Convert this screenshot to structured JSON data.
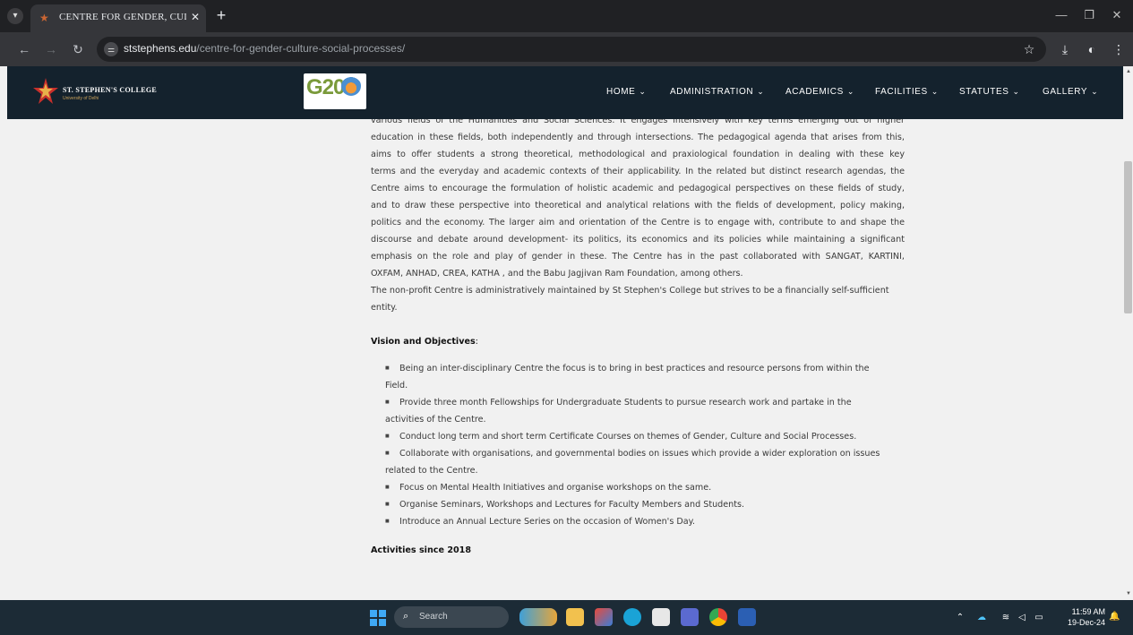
{
  "browser": {
    "tab_title": "CENTRE FOR GENDER, CULTUR",
    "url_host": "ststephens.edu",
    "url_path": "/centre-for-gender-culture-social-processes/"
  },
  "site": {
    "college_name": "ST. STEPHEN'S COLLEGE",
    "college_sub": "University of Delhi",
    "g20_label": "G20",
    "menu": [
      {
        "label": "HOME"
      },
      {
        "label": "ADMINISTRATION"
      },
      {
        "label": "ACADEMICS"
      },
      {
        "label": "FACILITIES"
      },
      {
        "label": "STATUTES"
      },
      {
        "label": "GALLERY"
      }
    ]
  },
  "content": {
    "para_lines": [
      "various fields of the Humanities and Social Sciences. It engages intensively with key terms emerging out of higher",
      "education in these fields, both independently and through intersections. The pedagogical agenda that arises from this,",
      "aims to offer students  a strong theoretical, methodological and praxiological foundation in dealing with these key",
      "terms and the everyday and academic contexts of their applicability. In the related but distinct research agendas, the",
      "Centre aims to encourage the formulation of holistic academic and pedagogical perspectives on these fields of study,",
      "and to draw these perspective into theoretical and analytical relations with the fields of development, policy making,",
      "politics and the economy. The larger aim and orientation of the Centre is to engage with, contribute to and shape the",
      "discourse and debate around development- its politics, its economics and its policies while maintaining a significant",
      "emphasis on the role and play of gender in these. The Centre has in the past collaborated with SANGAT, KARTINI,",
      "OXFAM, ANHAD, CREA, KATHA , and the Babu Jagjivan Ram Foundation, among others."
    ],
    "para2_line1": "The non-profit Centre is administratively maintained by St Stephen's College but strives to be a financially self-sufficient",
    "para2_line2": "entity.",
    "vision_heading": "Vision and Objectives",
    "vision_colon": ":",
    "objectives": [
      {
        "l1": "Being an inter-disciplinary Centre the focus is to bring in best practices and resource persons from within the",
        "l2": "Field."
      },
      {
        "l1": "Provide three month Fellowships for Undergraduate Students to pursue research work and partake in the",
        "l2": "activities of the Centre."
      },
      {
        "l1": "Conduct long term and short term  Certificate Courses on themes of Gender, Culture and Social Processes.",
        "l2": ""
      },
      {
        "l1": "Collaborate with organisations, and governmental bodies on issues which provide a wider exploration on issues",
        "l2": "related to the Centre."
      },
      {
        "l1": "Focus on Mental Health Initiatives and organise workshops on the same.",
        "l2": ""
      },
      {
        "l1": "Organise Seminars, Workshops and Lectures for Faculty Members and Students.",
        "l2": ""
      },
      {
        "l1": "Introduce an Annual Lecture Series on the occasion of Women's Day.",
        "l2": ""
      }
    ],
    "activities_heading": "Activities since 2018"
  },
  "taskbar": {
    "search_label": "Search",
    "time": "11:59 AM",
    "date": "19-Dec-24"
  },
  "colors": {
    "header_bg": "#14222d",
    "taskbar_bg": "#1c2b36",
    "page_bg": "#f1f1f1"
  }
}
